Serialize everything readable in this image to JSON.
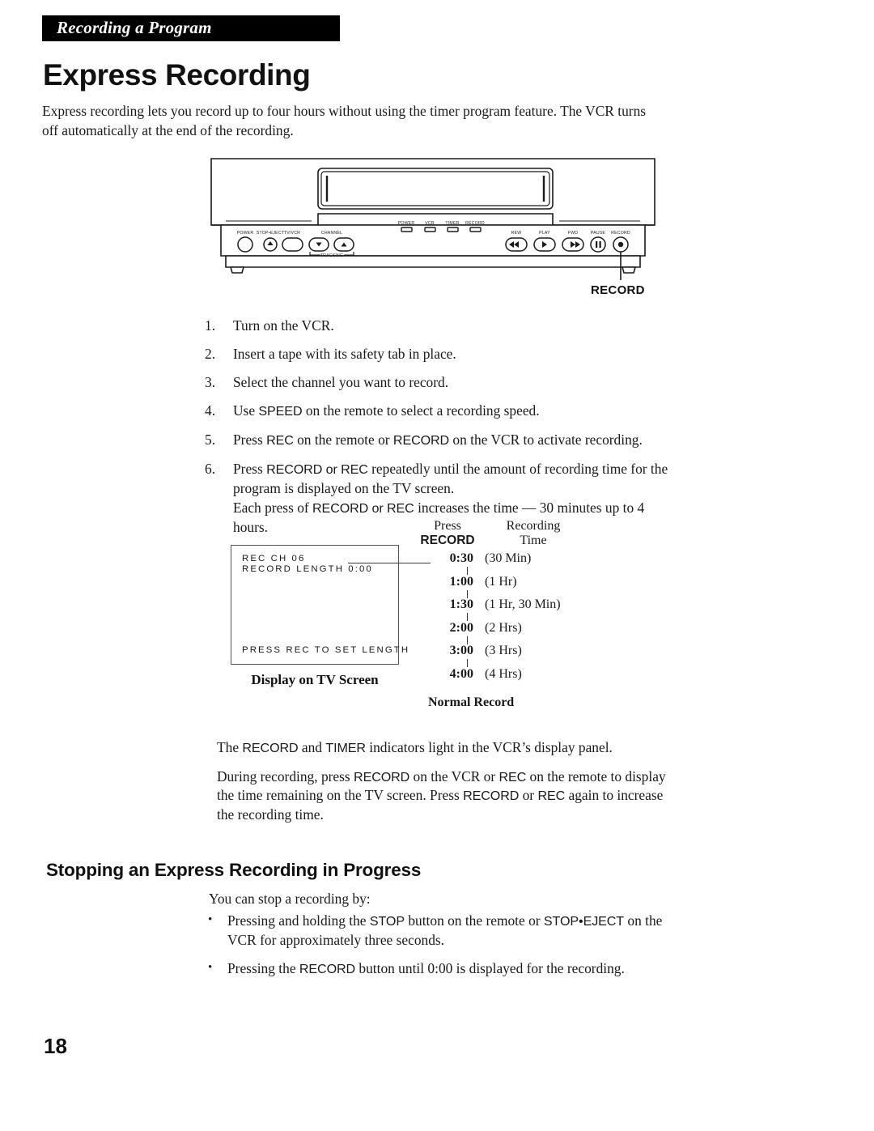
{
  "header": {
    "running_head": "Recording a Program"
  },
  "title": "Express Recording",
  "intro": "Express recording lets you record up to four hours without using the timer program feature.  The VCR turns off automatically at the end of the recording.",
  "figure": {
    "callout_label": "RECORD",
    "indicators": [
      "POWER",
      "VCR",
      "TIMER",
      "RECORD"
    ],
    "left_controls": [
      "POWER",
      "STOP•EJECT",
      "TV/VCR"
    ],
    "channel_label": "CHANNEL",
    "tracking_label": "TRACKING",
    "transport_controls": [
      "REW",
      "PLAY",
      "FWD",
      "PAUSE",
      "RECORD"
    ]
  },
  "steps": [
    {
      "num": "1.",
      "text": "Turn on the VCR."
    },
    {
      "num": "2.",
      "text": "Insert a tape with its safety tab in place."
    },
    {
      "num": "3.",
      "text": "Select the channel you want to record."
    },
    {
      "num": "4.",
      "pre": "Use ",
      "ui1": "SPEED",
      "post": " on the remote to select a recording speed."
    },
    {
      "num": "5.",
      "pre": "Press ",
      "ui1": "REC",
      "mid": " on the remote or ",
      "ui2": "RECORD",
      "post": " on the VCR to activate recording."
    },
    {
      "num": "6.",
      "pre": "Press ",
      "ui1": "RECORD or REC",
      "post": " repeatedly until the amount of recording time for the program is displayed on the TV screen.",
      "sub_pre": "Each press of ",
      "sub_ui": "RECORD or REC",
      "sub_post": " increases the time — 30 minutes up to 4 hours."
    }
  ],
  "tv_screen": {
    "line1": "REC       CH 06",
    "line2": "RECORD LENGTH 0:00",
    "line3": "PRESS REC TO SET LENGTH",
    "caption": "Display on TV Screen"
  },
  "time_table": {
    "header_press": "Press",
    "header_record": "RECORD",
    "header_recording": "Recording",
    "header_time": "Time",
    "rows": [
      {
        "time": "0:30",
        "label": "(30 Min)"
      },
      {
        "time": "1:00",
        "label": "(1 Hr)"
      },
      {
        "time": "1:30",
        "label": "(1 Hr, 30 Min)"
      },
      {
        "time": "2:00",
        "label": "(2 Hrs)"
      },
      {
        "time": "3:00",
        "label": "(3 Hrs)"
      },
      {
        "time": "4:00",
        "label": "(4 Hrs)"
      }
    ],
    "footer": "Normal Record"
  },
  "notes": [
    {
      "pre": "The ",
      "ui1": "RECORD",
      "mid": " and ",
      "ui2": "TIMER",
      "post": " indicators light in the VCR’s display panel."
    },
    {
      "pre": "During recording, press ",
      "ui1": "RECORD",
      "mid": " on the VCR or ",
      "ui2": "REC",
      "mid2": " on the remote to display the time remaining on the TV screen. Press ",
      "ui3": "RECORD",
      "mid3": " or ",
      "ui4": "REC",
      "post": " again to increase the recording time."
    }
  ],
  "stopping": {
    "heading": "Stopping an Express Recording in Progress",
    "intro": "You can stop a recording by:",
    "bullets": [
      {
        "pre": "Pressing and holding the ",
        "ui1": "STOP",
        "mid": " button on the remote or ",
        "ui2": "STOP•EJECT",
        "post": " on the VCR for approximately three seconds."
      },
      {
        "pre": "Pressing the ",
        "ui1": "RECORD",
        "post": " button until 0:00 is displayed for the recording."
      }
    ],
    "bullet_glyph": "•"
  },
  "page_number": "18"
}
